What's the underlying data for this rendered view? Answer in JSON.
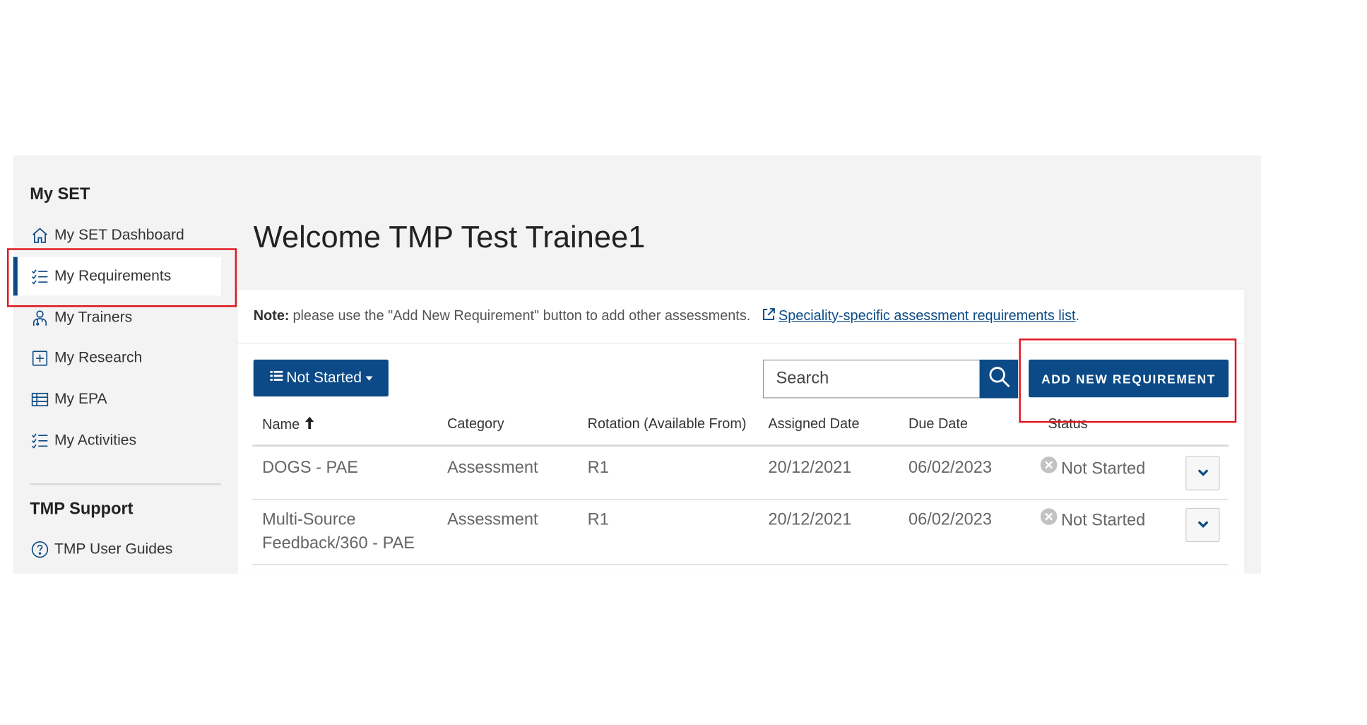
{
  "sidebar": {
    "section_title": "My SET",
    "items": [
      {
        "label": "My SET Dashboard",
        "icon": "home-icon"
      },
      {
        "label": "My Requirements",
        "icon": "checklist-icon",
        "active": true
      },
      {
        "label": "My Trainers",
        "icon": "trainer-icon"
      },
      {
        "label": "My Research",
        "icon": "research-icon"
      },
      {
        "label": "My EPA",
        "icon": "table-icon"
      },
      {
        "label": "My Activities",
        "icon": "checklist-icon"
      }
    ],
    "support_title": "TMP Support",
    "support_items": [
      {
        "label": "TMP User Guides",
        "icon": "help-circle-icon"
      }
    ]
  },
  "main": {
    "welcome": "Welcome TMP Test Trainee1",
    "note_label": "Note:",
    "note_text": "please use the \"Add New Requirement\" button to add other assessments.",
    "note_link": "Speciality-specific assessment requirements list",
    "note_link_suffix": ".",
    "filter_label": "Not Started",
    "search_placeholder": "Search",
    "add_button": "ADD NEW REQUIREMENT"
  },
  "table": {
    "columns": [
      "Name",
      "Category",
      "Rotation (Available From)",
      "Assigned Date",
      "Due Date",
      "Status"
    ],
    "sort_column": "Name",
    "rows": [
      {
        "name_line1": "DOGS - PAE",
        "name_line2": "",
        "category": "Assessment",
        "rotation": "R1",
        "assigned": "20/12/2021",
        "due": "06/02/2023",
        "status": "Not Started"
      },
      {
        "name_line1": "Multi-Source",
        "name_line2": "Feedback/360 - PAE",
        "category": "Assessment",
        "rotation": "R1",
        "assigned": "20/12/2021",
        "due": "06/02/2023",
        "status": "Not Started"
      }
    ]
  },
  "colors": {
    "primary": "#0b4a86",
    "highlight": "#e0161e",
    "panel_bg": "#f3f3f3"
  }
}
